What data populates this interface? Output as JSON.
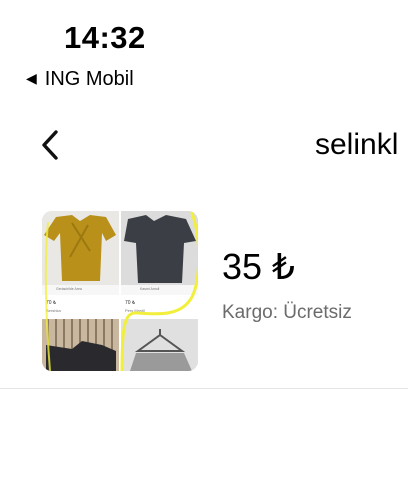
{
  "status_bar": {
    "time": "14:32",
    "back_app_label": "ING Mobil",
    "back_icon": "triangle-left-icon"
  },
  "header": {
    "back_icon": "chevron-left-icon",
    "title": "selinkl"
  },
  "product": {
    "price": "35 ₺",
    "shipping": "Kargo: Ücretsiz",
    "thumbnail_icon": "product-thumbnail",
    "tile_texts": [
      {
        "label": "Gerlachlide Area",
        "price": "70 ₺",
        "brand": "Bershka"
      },
      {
        "label": "Kasmi Amoll",
        "price": "70 ₺",
        "brand": "Pers Mastil"
      }
    ]
  },
  "colors": {
    "mustard": "#b8901a",
    "charcoal": "#3b3e44",
    "highlight": "#f2ef3c",
    "shipping_text": "#6b6b6b",
    "divider": "#e5e5e5"
  }
}
